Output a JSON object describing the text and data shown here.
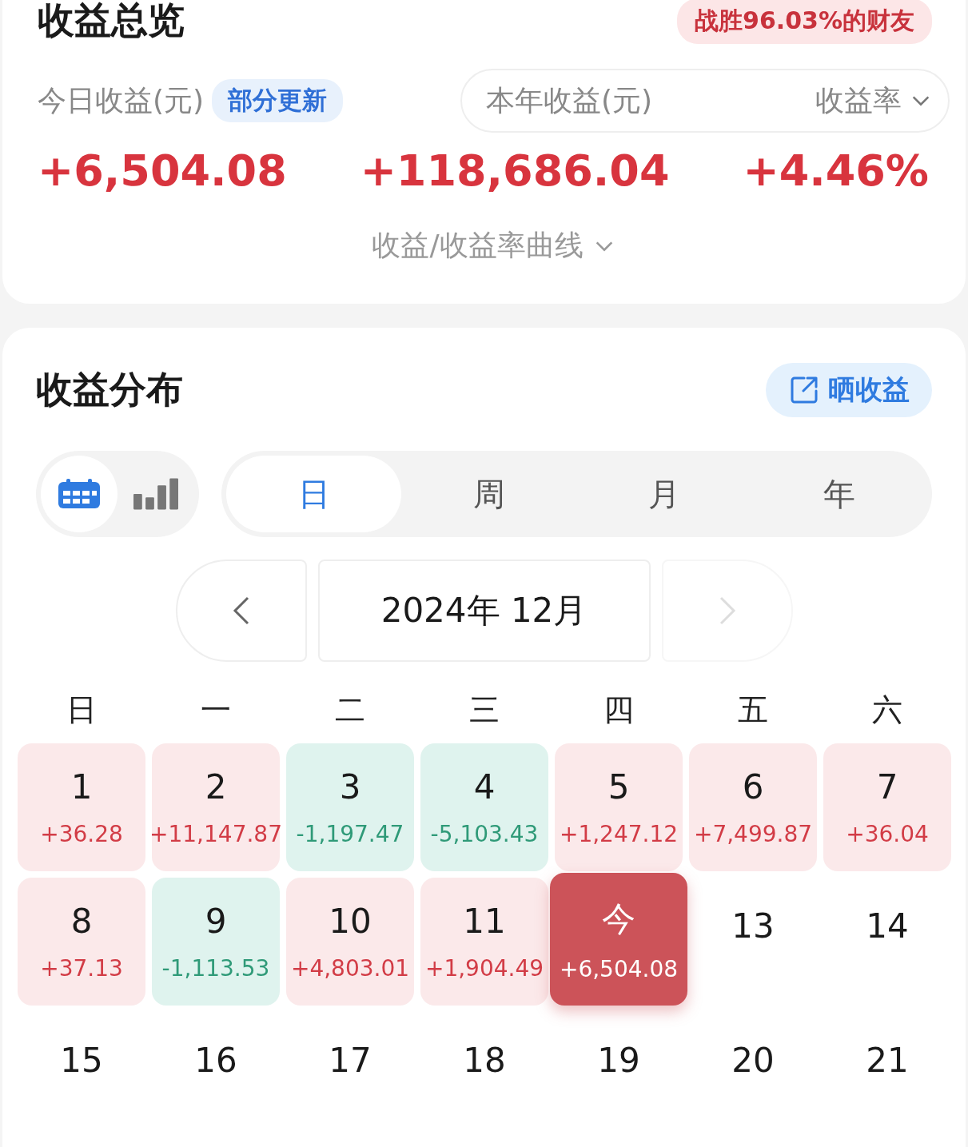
{
  "overview": {
    "title": "收益总览",
    "rank_badge": "战胜96.03%的财友",
    "today_label": "今日收益(元)",
    "today_badge": "部分更新",
    "year_label": "本年收益(元)",
    "rate_label": "收益率",
    "today_value": "+6,504.08",
    "year_value": "+118,686.04",
    "rate_value": "+4.46%",
    "curve_link": "收益/收益率曲线"
  },
  "distribution": {
    "title": "收益分布",
    "share_button": "晒收益",
    "view_modes": [
      {
        "kind": "calendar",
        "selected": true
      },
      {
        "kind": "bars",
        "selected": false
      }
    ],
    "periods": [
      {
        "label": "日",
        "selected": true
      },
      {
        "label": "周",
        "selected": false
      },
      {
        "label": "月",
        "selected": false
      },
      {
        "label": "年",
        "selected": false
      }
    ],
    "month": "2024年 12月",
    "next_disabled": true,
    "weekdays": [
      "日",
      "一",
      "二",
      "三",
      "四",
      "五",
      "六"
    ],
    "days": [
      {
        "day": "1",
        "value": "+36.28",
        "kind": "gain"
      },
      {
        "day": "2",
        "value": "+11,147.87",
        "kind": "gain"
      },
      {
        "day": "3",
        "value": "-1,197.47",
        "kind": "loss"
      },
      {
        "day": "4",
        "value": "-5,103.43",
        "kind": "loss"
      },
      {
        "day": "5",
        "value": "+1,247.12",
        "kind": "gain"
      },
      {
        "day": "6",
        "value": "+7,499.87",
        "kind": "gain"
      },
      {
        "day": "7",
        "value": "+36.04",
        "kind": "gain"
      },
      {
        "day": "8",
        "value": "+37.13",
        "kind": "gain"
      },
      {
        "day": "9",
        "value": "-1,113.53",
        "kind": "loss"
      },
      {
        "day": "10",
        "value": "+4,803.01",
        "kind": "gain"
      },
      {
        "day": "11",
        "value": "+1,904.49",
        "kind": "gain"
      },
      {
        "day": "今",
        "value": "+6,504.08",
        "kind": "today"
      },
      {
        "day": "13",
        "kind": "none"
      },
      {
        "day": "14",
        "kind": "none"
      },
      {
        "day": "15",
        "kind": "none"
      },
      {
        "day": "16",
        "kind": "none"
      },
      {
        "day": "17",
        "kind": "none"
      },
      {
        "day": "18",
        "kind": "none"
      },
      {
        "day": "19",
        "kind": "none"
      },
      {
        "day": "20",
        "kind": "none"
      },
      {
        "day": "21",
        "kind": "none"
      }
    ]
  }
}
